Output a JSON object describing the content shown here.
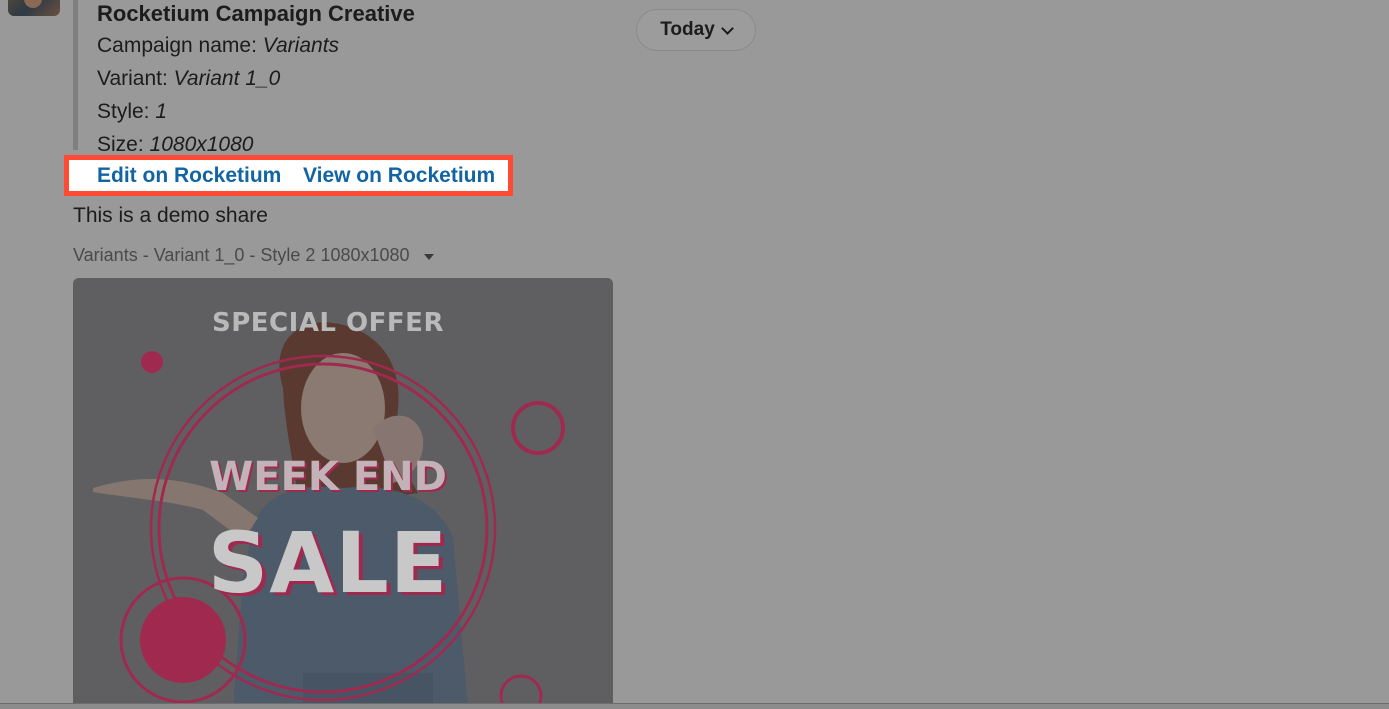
{
  "message": {
    "attachment_title": "Rocketium Campaign Creative",
    "fields": [
      {
        "label": "Campaign name: ",
        "value": "Variants"
      },
      {
        "label": "Variant: ",
        "value": "Variant 1_0"
      },
      {
        "label": "Style: ",
        "value": "1"
      },
      {
        "label": "Size: ",
        "value": "1080x1080"
      }
    ],
    "actions": {
      "edit_label": "Edit on Rocketium",
      "view_label": "View on Rocketium"
    },
    "text": "This is a demo share",
    "file_label": "Variants - Variant 1_0 - Style 2 1080x1080"
  },
  "date_divider": {
    "label": "Today"
  },
  "creative": {
    "offer_text": "SPECIAL OFFER",
    "headline": "WEEK END",
    "sale_text": "SALE"
  },
  "colors": {
    "overlay_background": "#999999",
    "link": "#1264a3",
    "highlight_border": "#ff4b33",
    "accent_circles": "#a0294f"
  },
  "icons": {
    "file_menu": "caret-down-icon",
    "date_menu": "chevron-down-icon"
  }
}
